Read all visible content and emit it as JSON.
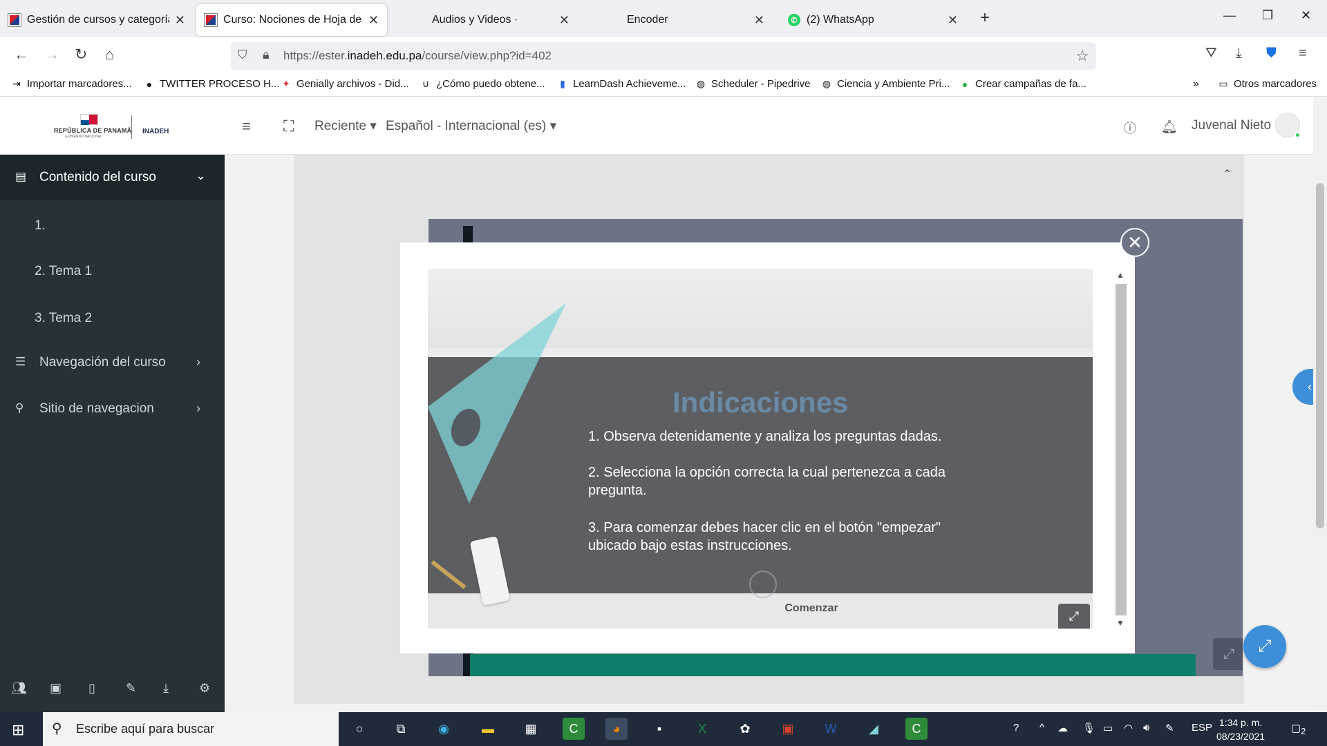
{
  "browser": {
    "tabs": [
      {
        "title": "Gestión de cursos y categorías",
        "icon": "inadeh-favicon",
        "active": false
      },
      {
        "title": "Curso: Nociones de Hoja de Cá",
        "icon": "inadeh-favicon",
        "active": true
      },
      {
        "title": "Audios y Videos ·",
        "icon": "",
        "active": false
      },
      {
        "title": "Encoder",
        "icon": "",
        "active": false
      },
      {
        "title": "(2) WhatsApp",
        "icon": "whatsapp-favicon",
        "active": false
      }
    ],
    "new_tab_label": "+",
    "url_prefix": "https://ester.",
    "url_domain": "inadeh.edu.pa",
    "url_path": "/course/view.php?id=402",
    "bookmarks": [
      "Importar marcadores...",
      "TWITTER PROCESO H...",
      "Genially archivos - Did...",
      "¿Cómo puedo obtene...",
      "LearnDash Achieveme...",
      "Scheduler - Pipedrive",
      "Ciencia y Ambiente Pri...",
      "Crear campañas de fa..."
    ],
    "other_bookmarks": "Otros marcadores"
  },
  "site": {
    "logo_country": "REPÚBLICA DE PANAMÁ",
    "logo_gov": "GOBIERNO NACIONAL",
    "logo_org": "INADEH",
    "recent_label": "Reciente",
    "language_label": "Español - Internacional (es)",
    "user_name": "Juvenal Nieto"
  },
  "sidebar": {
    "header": "Contenido del curso",
    "sections": [
      "1.",
      "2.  Tema 1",
      "3.  Tema 2"
    ],
    "nav_items": [
      "Navegación del curso",
      "Sitio de navegacion"
    ]
  },
  "activity": {
    "title": "Indicaciones",
    "instructions": [
      "1. Observa detenidamente y analiza los preguntas dadas.",
      "2. Selecciona la opción correcta la cual pertenezca a cada pregunta.",
      "3. Para comenzar debes hacer clic en el botón \"empezar\" ubicado bajo estas instrucciones."
    ],
    "start_label": "Comenzar"
  },
  "taskbar": {
    "search_placeholder": "Escribe aquí para buscar",
    "language": "ESP",
    "time": "1:34 p. m.",
    "date": "08/23/2021",
    "notifications": "2"
  },
  "colors": {
    "sidebar_bg": "#263238",
    "accent": "#3d8fd9",
    "stage_bg": "#6d7385",
    "activity_title": "#6a8aa5"
  }
}
